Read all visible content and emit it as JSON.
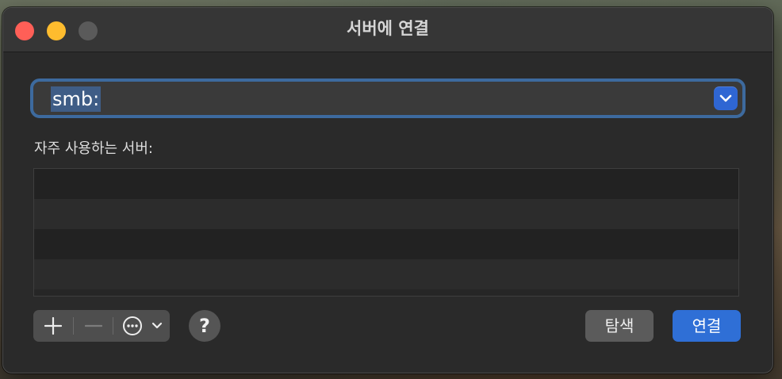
{
  "window": {
    "title": "서버에 연결"
  },
  "address": {
    "value": "smb:",
    "dropdown_icon": "chevron-down-icon"
  },
  "favorites": {
    "label": "자주 사용하는 서버:",
    "items": []
  },
  "toolbar": {
    "add_icon": "plus-icon",
    "remove_icon": "minus-icon",
    "more_icon": "ellipsis-circle-icon",
    "help_label": "?"
  },
  "buttons": {
    "browse_label": "탐색",
    "connect_label": "연결"
  },
  "colors": {
    "accent": "#2f6fd6",
    "focus_ring": "#3d6a9e",
    "close": "#ff5f57",
    "minimize": "#febc2e"
  }
}
